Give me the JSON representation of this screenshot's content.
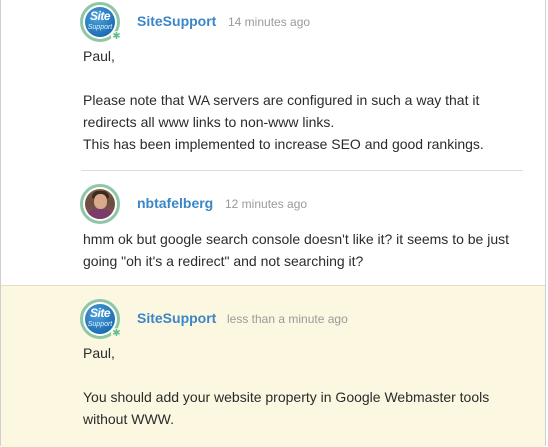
{
  "comments": [
    {
      "author": "SiteSupport",
      "time": "14 minutes ago",
      "avatar": {
        "type": "logo",
        "line1": "Site",
        "line2": "Support"
      },
      "salutation": "Paul,",
      "lines": [
        "Please note that WA servers are configured in such a way that it",
        "redirects all www links to non-www links.",
        "This has been implemented to increase SEO and good rankings."
      ],
      "highlighted": false
    },
    {
      "author": "nbtafelberg",
      "time": "12 minutes ago",
      "avatar": {
        "type": "photo"
      },
      "lines": [
        "hmm ok but google search console doesn't like it? it seems to be just",
        "going \"oh it's a redirect\" and not searching it?"
      ],
      "highlighted": false
    },
    {
      "author": "SiteSupport",
      "time": "less than a minute ago",
      "avatar": {
        "type": "logo",
        "line1": "Site",
        "line2": "Support"
      },
      "salutation": "Paul,",
      "lines": [
        "You should add your website property in Google Webmaster tools",
        "without WWW."
      ],
      "highlighted": true
    }
  ],
  "colors": {
    "author_link": "#3b86c6",
    "timestamp": "#9a9a9a",
    "highlight_background": "#fbf7e0",
    "avatar_ring": "#8ec6a6",
    "logo_blue": "#1d6fb3"
  },
  "icons": {
    "status": "online-indicator-icon",
    "status_glyph": "✱"
  }
}
